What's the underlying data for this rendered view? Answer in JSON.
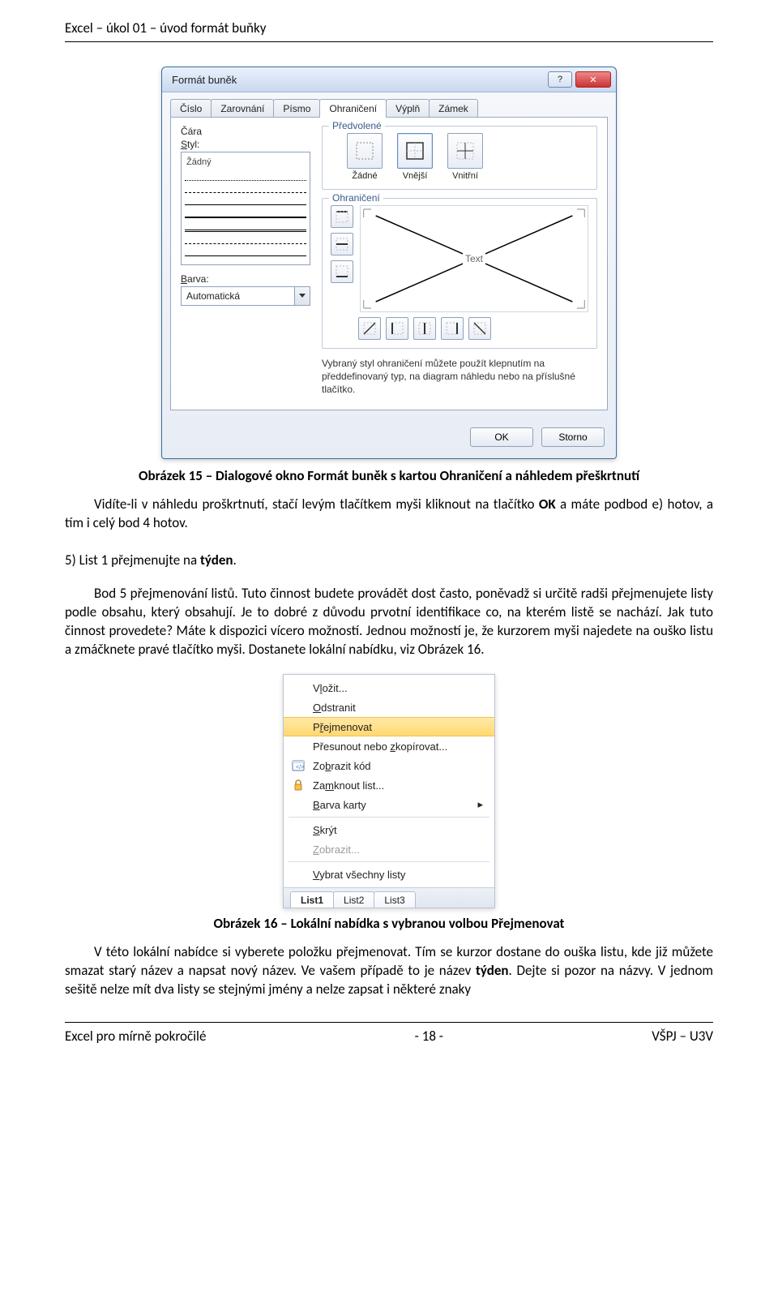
{
  "doc_header": "Excel – úkol 01 – úvod formát buňky",
  "footer": {
    "left": "Excel pro mírně pokročilé",
    "center": "- 18 -",
    "right": "VŠPJ – U3V"
  },
  "dialog": {
    "title": "Formát buněk",
    "help_icon": "?",
    "close_icon": "✕",
    "tabs": [
      "Číslo",
      "Zarovnání",
      "Písmo",
      "Ohraničení",
      "Výplň",
      "Zámek"
    ],
    "active_tab": "Ohraničení",
    "cara_label": "Čára",
    "styl_label": "Styl:",
    "styl_none": "Žádný",
    "barva_label": "Barva:",
    "barva_value": "Automatická",
    "presets_group": "Předvolené",
    "presets": [
      {
        "label": "Žádné",
        "icon": "none"
      },
      {
        "label": "Vnější",
        "icon": "outer"
      },
      {
        "label": "Vnitřní",
        "icon": "inner"
      }
    ],
    "ohraniceni_group": "Ohraničení",
    "preview_text": "Text",
    "desc": "Vybraný styl ohraničení můžete použít klepnutím na předdefinovaný typ, na diagram náhledu nebo na příslušné tlačítko.",
    "ok": "OK",
    "storno": "Storno"
  },
  "caption1": "Obrázek 15 – Dialogové okno Formát buněk s kartou Ohraničení a náhledem přeškrtnutí",
  "para1_a": "Vidíte-li v náhledu proškrtnutí, stačí levým tlačítkem myši kliknout na tlačítko ",
  "para1_b": "OK",
  "para1_c": " a máte podbod e) hotov, a tím i celý bod 4 hotov.",
  "para2_a": "5)   List 1 přejmenujte na ",
  "para2_b": "týden",
  "para2_c": ".",
  "para3": "Bod 5 přejmenování listů. Tuto činnost budete provádět dost často, poněvadž si určitě radši přejmenujete listy podle obsahu, který obsahují. Je to dobré z důvodu prvotní identifikace co, na kterém listě se nachází. Jak tuto činnost provedete? Máte k dispozici vícero možností. Jednou možností je, že kurzorem myši najedete na ouško listu a zmáčknete pravé tlačítko myši. Dostanete lokální nabídku, viz Obrázek 16.",
  "ctx": {
    "items": [
      {
        "label": "Vložit...",
        "ul": "V",
        "disabled": false
      },
      {
        "label": "Odstranit",
        "ul": "O",
        "disabled": false
      },
      {
        "label": "Přejmenovat",
        "ul": "ř",
        "disabled": false,
        "sel": true
      },
      {
        "label": "Přesunout nebo zkopírovat...",
        "ul": "z",
        "disabled": false
      },
      {
        "label": "Zobrazit kód",
        "ul": "b",
        "disabled": false,
        "icon": "code"
      },
      {
        "label": "Zamknout list...",
        "ul": "m",
        "disabled": false,
        "icon": "lock"
      },
      {
        "label": "Barva karty",
        "ul": "B",
        "disabled": false,
        "sub": true
      },
      {
        "label": "Skrýt",
        "ul": "S",
        "disabled": false
      },
      {
        "label": "Zobrazit...",
        "ul": "Z",
        "disabled": true
      },
      {
        "label": "Vybrat všechny listy",
        "ul": "V",
        "disabled": false
      }
    ],
    "sheets": [
      "List1",
      "List2",
      "List3"
    ]
  },
  "caption2": "Obrázek 16 – Lokální nabídka s vybranou volbou Přejmenovat",
  "para4_a": "V této lokální nabídce si vyberete položku přejmenovat. Tím se kurzor dostane do ouška listu, kde již můžete smazat starý název a napsat nový název. Ve vašem případě to je název ",
  "para4_b": "týden",
  "para4_c": ". Dejte si pozor na názvy. V jednom sešitě nelze mít dva listy se stejnými jmény a nelze zapsat i některé znaky"
}
